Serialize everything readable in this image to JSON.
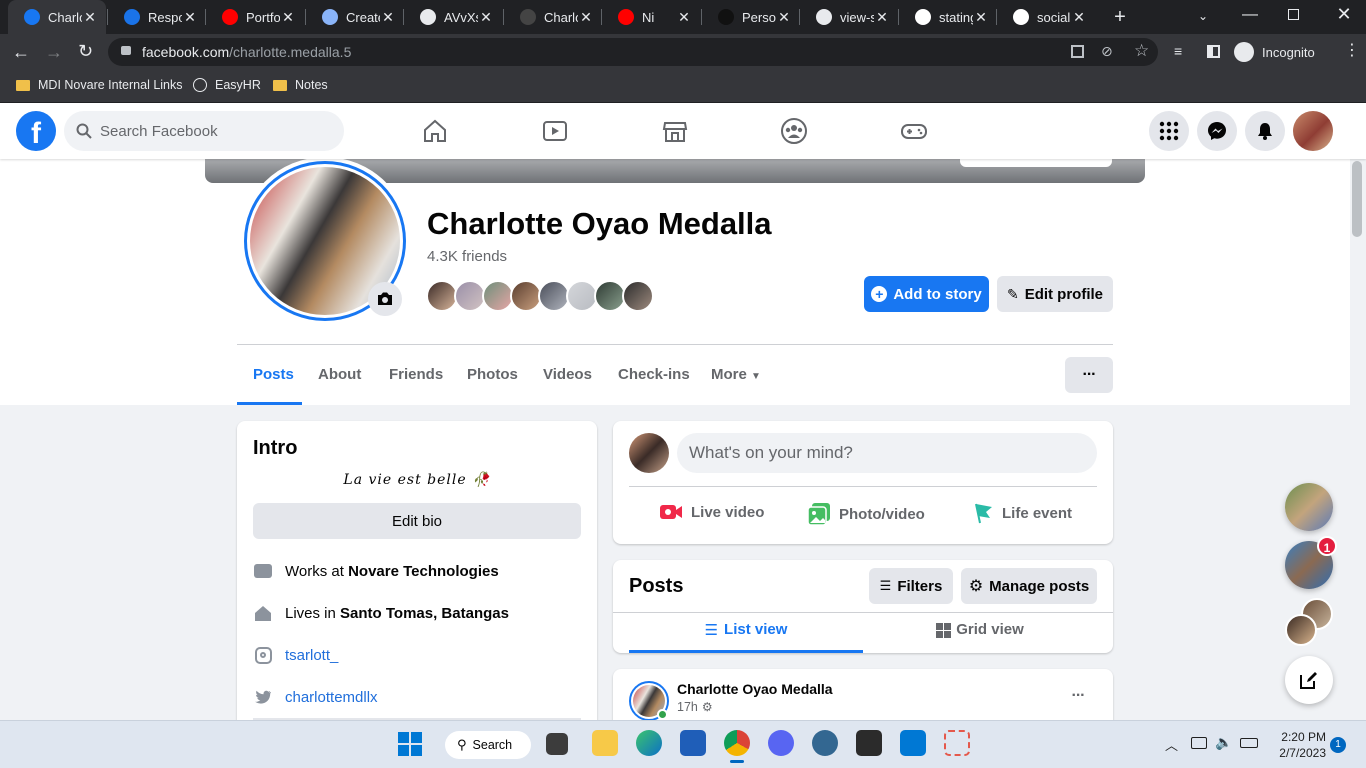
{
  "browser": {
    "tabs": [
      {
        "title": "Charlo",
        "icon": "facebook-icon",
        "color": "#1877f2"
      },
      {
        "title": "Respo",
        "icon": "cn-icon",
        "color": "#1a73e8"
      },
      {
        "title": "Portfol",
        "icon": "youtube-icon",
        "color": "#ff0000"
      },
      {
        "title": "Create",
        "icon": "github-icon",
        "color": "#8ab4f8"
      },
      {
        "title": "AVvXs",
        "icon": "globe-icon",
        "color": "#e8eaed"
      },
      {
        "title": "Charlo",
        "icon": "github-dark-icon",
        "color": "#444"
      },
      {
        "title": "Ni",
        "icon": "youtube-icon",
        "color": "#ff0000"
      },
      {
        "title": "Person",
        "icon": "code-icon",
        "color": "#111"
      },
      {
        "title": "view-s",
        "icon": "globe-icon",
        "color": "#e8eaed"
      },
      {
        "title": "stating",
        "icon": "google-icon",
        "color": "#fff"
      },
      {
        "title": "social",
        "icon": "google-icon",
        "color": "#fff"
      }
    ],
    "url_domain": "facebook.com",
    "url_path": "/charlotte.medalla.5",
    "profile_label": "Incognito",
    "bookmarks": [
      "MDI Novare Internal Links",
      "EasyHR",
      "Notes"
    ]
  },
  "fb": {
    "search_placeholder": "Search Facebook",
    "notification_badge": "1"
  },
  "profile": {
    "name": "Charlotte Oyao Medalla",
    "friends_count": "4.3K friends",
    "add_story_label": "Add to story",
    "edit_profile_label": "Edit profile",
    "tabs": [
      "Posts",
      "About",
      "Friends",
      "Photos",
      "Videos",
      "Check-ins",
      "More"
    ],
    "more_options": "···"
  },
  "intro": {
    "title": "Intro",
    "bio": "La vie est belle 🥀",
    "edit_bio_label": "Edit bio",
    "works_prefix": "Works at ",
    "works_place": "Novare Technologies",
    "lives_prefix": "Lives in ",
    "lives_place": "Santo Tomas, Batangas",
    "instagram": "tsarlott_",
    "twitter": "charlottemdllx"
  },
  "composer": {
    "placeholder": "What's on your mind?",
    "live_label": "Live video",
    "photo_label": "Photo/video",
    "life_label": "Life event"
  },
  "posts_header": {
    "title": "Posts",
    "filters_label": "Filters",
    "manage_label": "Manage posts",
    "list_view_label": "List view",
    "grid_view_label": "Grid view"
  },
  "post": {
    "author": "Charlotte Oyao Medalla",
    "time": "17h",
    "menu": "···"
  },
  "taskbar": {
    "search_label": "Search",
    "time": "2:20 PM",
    "date": "2/7/2023",
    "notif_count": "1"
  },
  "colors": {
    "fb_blue": "#1877f2",
    "chrome_dark": "#202124"
  }
}
